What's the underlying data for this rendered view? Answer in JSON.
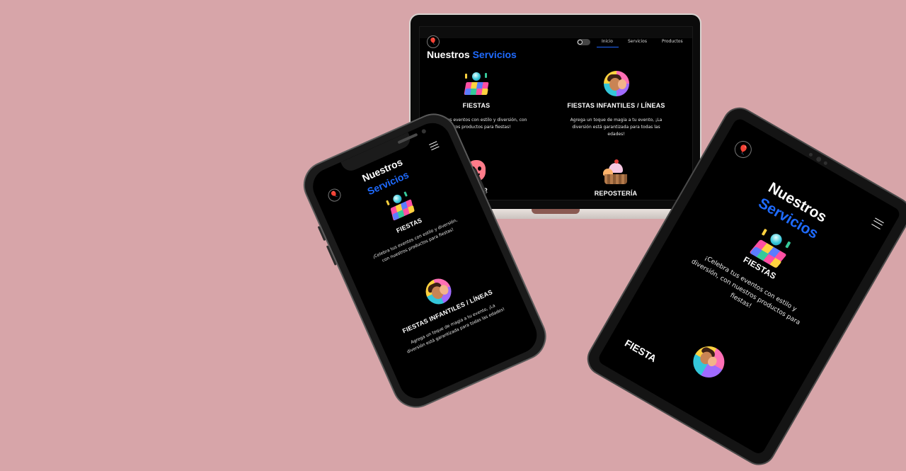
{
  "brand": {
    "logo_icon": "balloon-logo-icon"
  },
  "nav": {
    "items": [
      "Inicio",
      "Servicios",
      "Productos"
    ],
    "active": "Inicio"
  },
  "section": {
    "title_part1": "Nuestros",
    "title_part2": "Servicios"
  },
  "services": [
    {
      "title": "FIESTAS",
      "description": "¡Celebra tus eventos con estilo y diversión, con nuestros productos para fiestas!",
      "icon": "party-disco-icon"
    },
    {
      "title": "FIESTAS INFANTILES / LÍNEAS",
      "description": "Agrega un toque de magia a tu evento, ¡La diversión está garantizada para todas las edades!",
      "icon": "kids-party-icon"
    },
    {
      "title": "FLÚOR",
      "description": "",
      "icon": "fluor-mask-icon"
    },
    {
      "title": "REPOSTERÍA",
      "description": "",
      "icon": "cupcake-icon"
    }
  ],
  "tablet_partial_title": "FIESTA",
  "colors": {
    "background": "#d7a5a9",
    "screen": "#000000",
    "accent": "#1f6bff",
    "text": "#ffffff"
  }
}
